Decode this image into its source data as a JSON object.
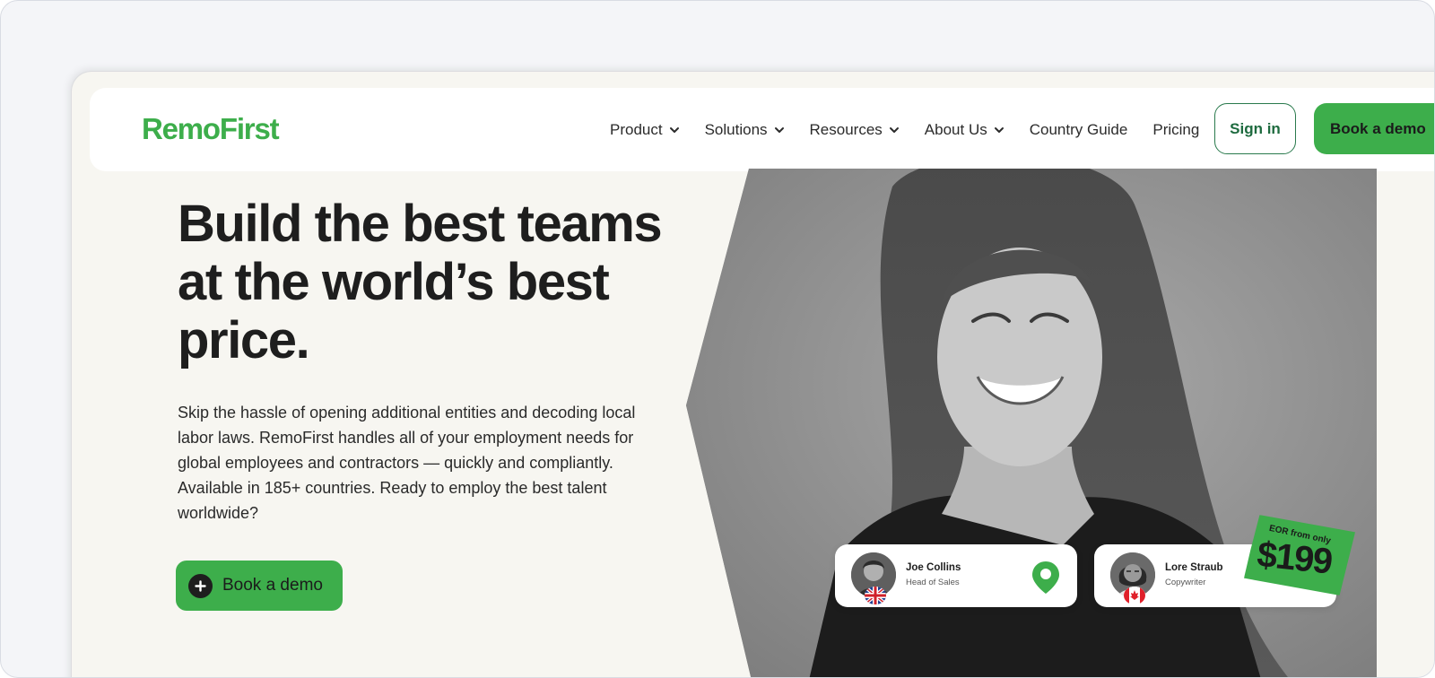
{
  "brand": {
    "logo_text": "RemoFirst",
    "accent_color": "#3dae4b",
    "dark_green": "#1e6b3f"
  },
  "nav": {
    "items": [
      {
        "label": "Product",
        "has_dropdown": true
      },
      {
        "label": "Solutions",
        "has_dropdown": true
      },
      {
        "label": "Resources",
        "has_dropdown": true
      },
      {
        "label": "About Us",
        "has_dropdown": true
      },
      {
        "label": "Country Guide",
        "has_dropdown": false
      },
      {
        "label": "Pricing",
        "has_dropdown": false
      }
    ],
    "signin_label": "Sign in",
    "demo_label": "Book a demo"
  },
  "hero": {
    "title": "Build the best teams at the world’s best price.",
    "description": "Skip the hassle of opening additional entities and decoding local labor laws. RemoFirst handles all of your employment needs for global employees and contractors — quickly and compliantly. Available in 185+ countries. Ready to employ the best talent worldwide?",
    "cta_label": "Book a demo",
    "cta_icon": "plus-circle-icon"
  },
  "profiles": [
    {
      "name": "Joe Collins",
      "role": "Head of Sales",
      "flag": "uk-flag-icon",
      "icon": "location-pin-icon"
    },
    {
      "name": "Lore Straub",
      "role": "Copywriter",
      "flag": "canada-flag-icon"
    }
  ],
  "price_badge": {
    "small_text": "EOR from only",
    "price": "$199"
  }
}
